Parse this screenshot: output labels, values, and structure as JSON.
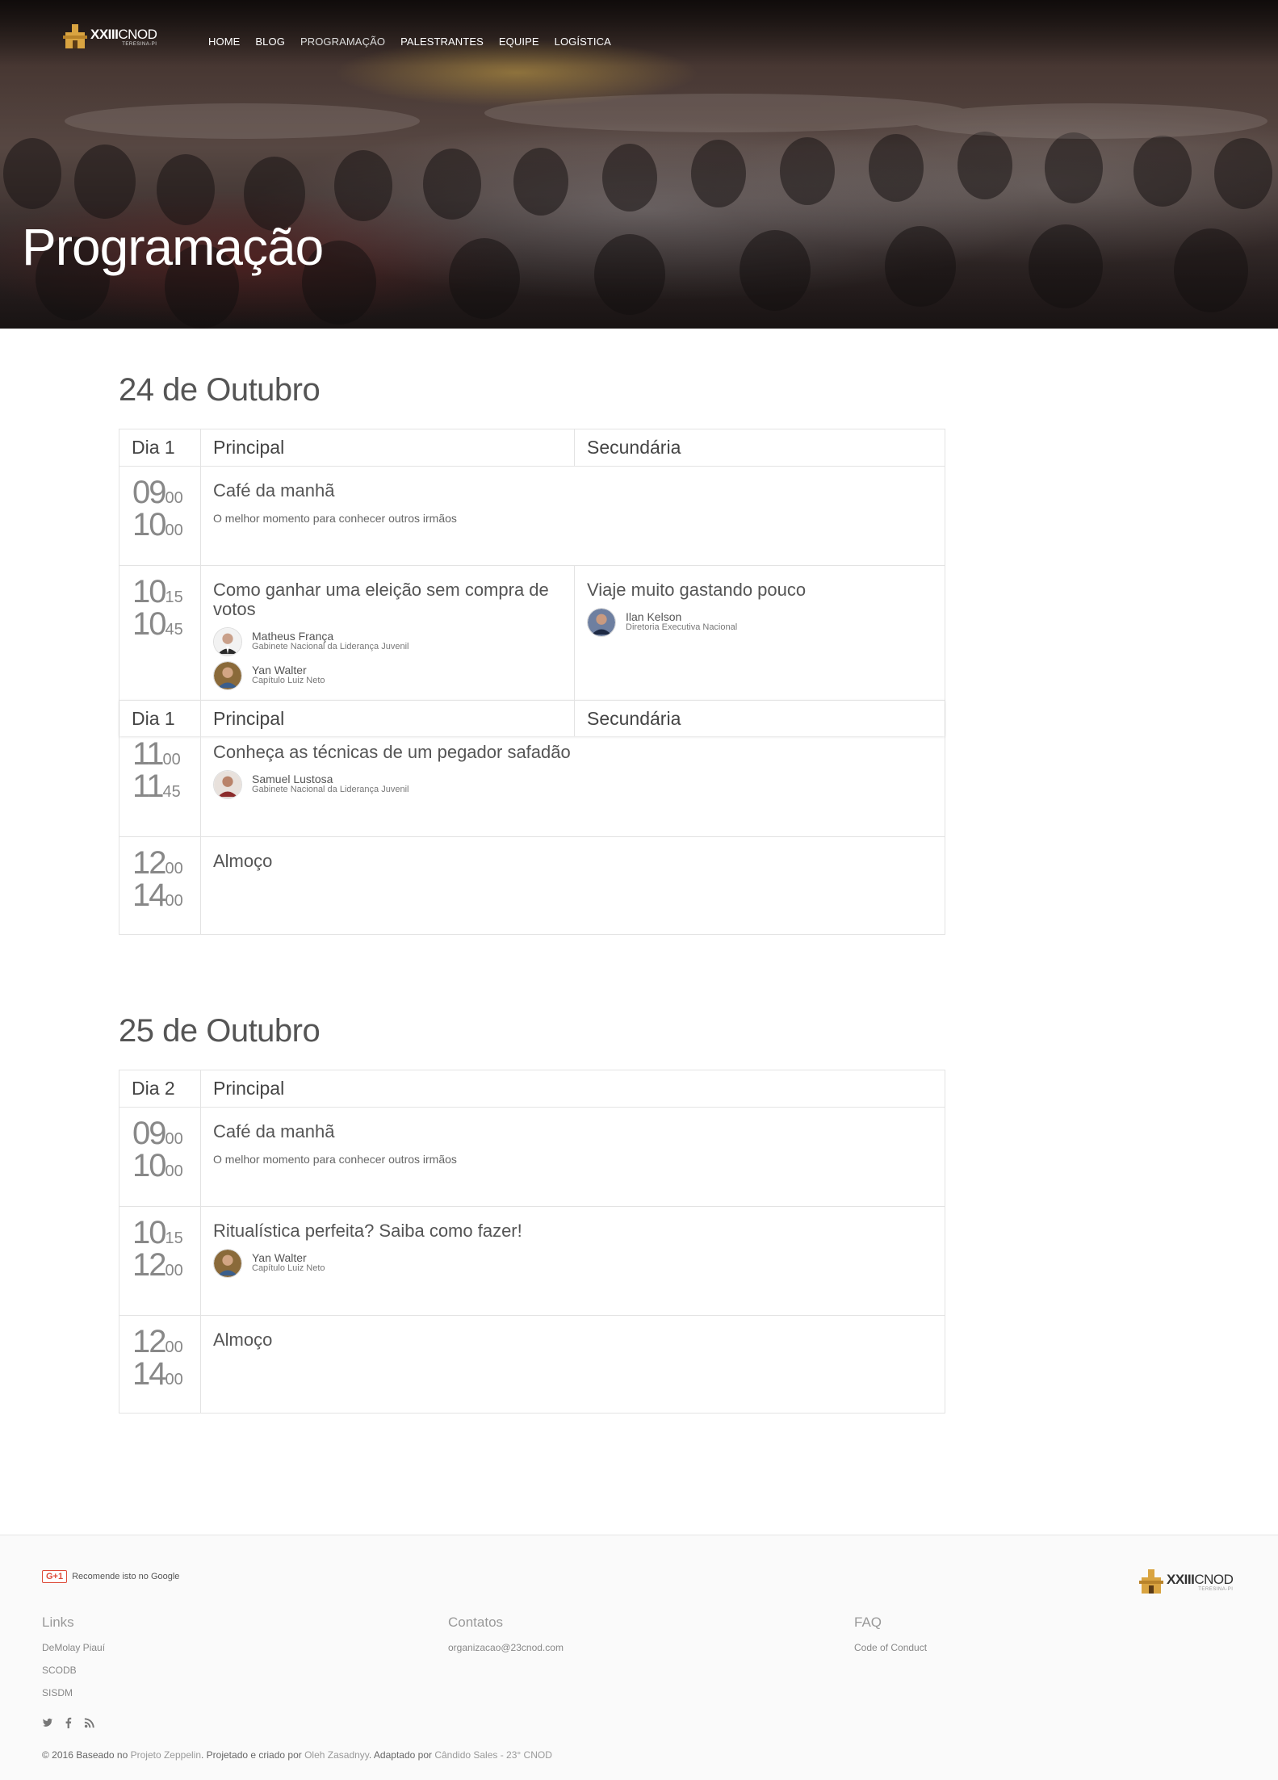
{
  "header": {
    "logo": {
      "brand_bold": "XXIII",
      "brand_light": "CNOD",
      "subtitle": "TERESINA-PI"
    },
    "nav": [
      "HOME",
      "BLOG",
      "PROGRAMAÇÃO",
      "PALESTRANTES",
      "EQUIPE",
      "LOGÍSTICA"
    ],
    "hero_title": "Programação"
  },
  "days": [
    {
      "date": "24 de Outubro",
      "header": {
        "day": "Dia 1",
        "main": "Principal",
        "secondary": "Secundária"
      },
      "slots": [
        {
          "start": {
            "h": "09",
            "m": "00"
          },
          "end": {
            "h": "10",
            "m": "00"
          },
          "title": "Café da manhã",
          "desc": "O melhor momento para conhecer outros irmãos"
        },
        {
          "start": {
            "h": "10",
            "m": "15"
          },
          "end": {
            "h": "10",
            "m": "45"
          },
          "main": {
            "title": "Como ganhar uma eleição sem compra de votos",
            "speakers": [
              {
                "name": "Matheus França",
                "role": "Gabinete Nacional da Liderança Juvenil"
              },
              {
                "name": "Yan Walter",
                "role": "Capítulo Luiz Neto"
              }
            ]
          },
          "secondary": {
            "title": "Viaje muito gastando pouco",
            "speakers": [
              {
                "name": "Ilan Kelson",
                "role": "Diretoria Executiva Nacional"
              }
            ]
          }
        },
        {
          "start": {
            "h": "11",
            "m": "00"
          },
          "end": {
            "h": "11",
            "m": "45"
          },
          "title": "Conheça as técnicas de um pegador safadão",
          "speakers": [
            {
              "name": "Samuel Lustosa",
              "role": "Gabinete Nacional da Liderança Juvenil"
            }
          ]
        },
        {
          "start": {
            "h": "12",
            "m": "00"
          },
          "end": {
            "h": "14",
            "m": "00"
          },
          "title": "Almoço"
        }
      ]
    },
    {
      "date": "25 de Outubro",
      "header": {
        "day": "Dia 2",
        "main": "Principal"
      },
      "slots": [
        {
          "start": {
            "h": "09",
            "m": "00"
          },
          "end": {
            "h": "10",
            "m": "00"
          },
          "title": "Café da manhã",
          "desc": "O melhor momento para conhecer outros irmãos"
        },
        {
          "start": {
            "h": "10",
            "m": "15"
          },
          "end": {
            "h": "12",
            "m": "00"
          },
          "title": "Ritualística perfeita? Saiba como fazer!",
          "speakers": [
            {
              "name": "Yan Walter",
              "role": "Capítulo Luiz Neto"
            }
          ]
        },
        {
          "start": {
            "h": "12",
            "m": "00"
          },
          "end": {
            "h": "14",
            "m": "00"
          },
          "title": "Almoço"
        }
      ]
    }
  ],
  "footer": {
    "gplus_button": "G+1",
    "gplus_text": "Recomende isto no Google",
    "links": {
      "title": "Links",
      "items": [
        "DeMolay Piauí",
        "SCODB",
        "SISDM"
      ]
    },
    "contacts": {
      "title": "Contatos",
      "items": [
        "organizacao@23cnod.com"
      ]
    },
    "faq": {
      "title": "FAQ",
      "items": [
        "Code of Conduct"
      ]
    },
    "social_icons": [
      "twitter-icon",
      "facebook-icon",
      "rss-icon"
    ],
    "copyright": {
      "prefix": "© 2016 Baseado no",
      "project": "Projeto Zeppelin",
      "mid": ". Projetado e criado por",
      "author": "Oleh Zasadnyy",
      "mid2": ". Adaptado por",
      "adapter": "Cândido Sales - 23° CNOD"
    }
  },
  "colors": {
    "accent": "#dd4b39",
    "logo_gold": "#d9a441",
    "border": "#e3e3e3"
  }
}
